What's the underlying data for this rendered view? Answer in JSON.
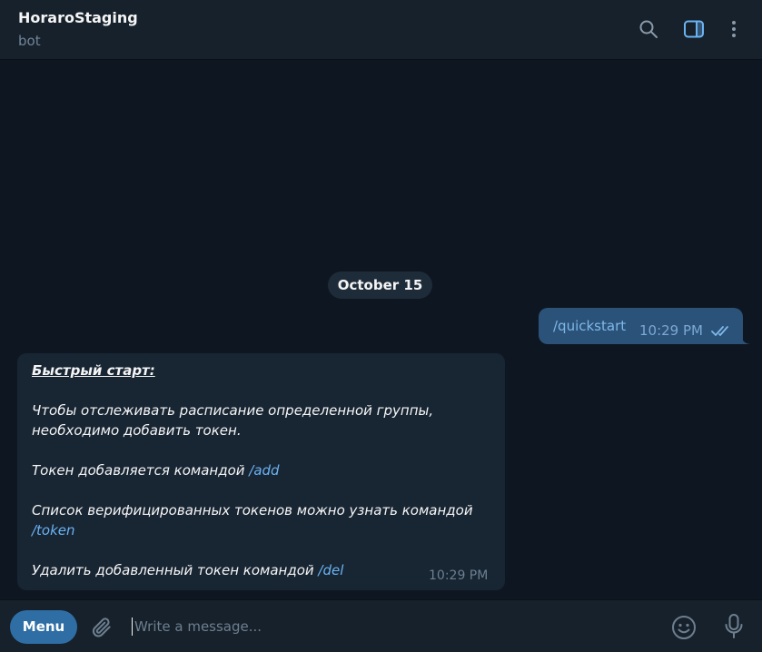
{
  "header": {
    "title": "HoraroStaging",
    "subtitle": "bot",
    "icons": [
      "search-icon",
      "sidebar-toggle-icon",
      "more-vertical-icon"
    ]
  },
  "chat": {
    "date_separator": "October 15",
    "outgoing": {
      "text": "/quickstart",
      "time": "10:29 PM",
      "status_icon": "double-check-icon"
    },
    "incoming": {
      "heading": "Быстрый старт:",
      "para1_line1": "Чтобы отслеживать расписание определенной группы,",
      "para1_line2": "необходимо добавить токен.",
      "para2_text": "Токен добавляется командой ",
      "para2_cmd": "/add",
      "para3_text": "Список верифицированных токенов можно узнать командой",
      "para3_cmd": "/token",
      "para4_text": "Удалить добавленный токен командой ",
      "para4_cmd": "/del",
      "time": "10:29 PM"
    }
  },
  "composer": {
    "menu_label": "Menu",
    "placeholder": "Write a message...",
    "value": "",
    "icons": [
      "paperclip-icon",
      "emoji-icon",
      "microphone-icon"
    ]
  },
  "colors": {
    "background": "#0e1621",
    "header": "#17212b",
    "outgoing_bubble": "#2b5278",
    "incoming_bubble": "#182533",
    "link": "#6ab3f3",
    "menu_button": "#2f6ea5"
  }
}
